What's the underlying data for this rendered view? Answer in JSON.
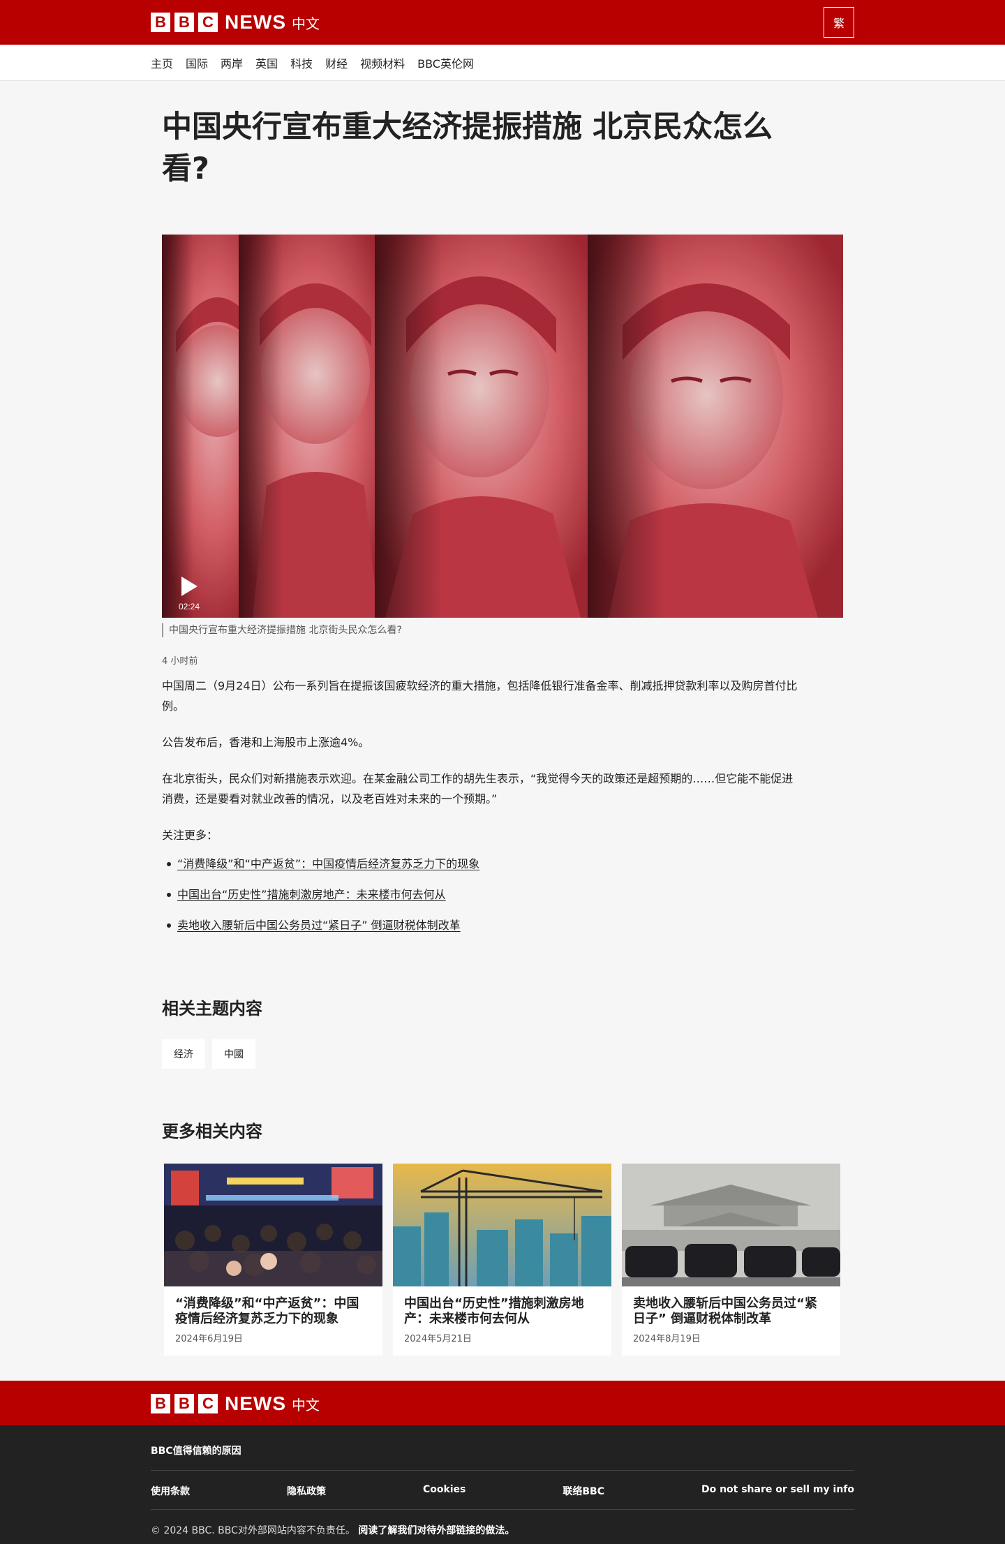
{
  "header": {
    "logo_letters": [
      "B",
      "B",
      "C"
    ],
    "logo_news": "NEWS",
    "logo_lang": "中文",
    "traditional_button": "繁"
  },
  "nav": {
    "items": [
      {
        "label": "主页"
      },
      {
        "label": "国际"
      },
      {
        "label": "两岸"
      },
      {
        "label": "英国"
      },
      {
        "label": "科技"
      },
      {
        "label": "财经"
      },
      {
        "label": "视频材料"
      },
      {
        "label": "BBC英伦网"
      }
    ]
  },
  "article": {
    "headline": "中国央行宣布重大经济提振措施 北京民众怎么看?",
    "video_duration": "02:24",
    "caption": "中国央行宣布重大经济提振措施 北京街头民众怎么看?",
    "timestamp": "4 小时前",
    "paragraphs": [
      "中国周二（9月24日）公布一系列旨在提振该国疲软经济的重大措施，包括降低银行准备金率、削减抵押贷款利率以及购房首付比例。",
      "公告发布后，香港和上海股市上涨逾4%。",
      "在北京街头，民众们对新措施表示欢迎。在某金融公司工作的胡先生表示，“我觉得今天的政策还是超预期的……但它能不能促进消费，还是要看对就业改善的情况，以及老百姓对未来的一个预期。”",
      "关注更多："
    ],
    "links": [
      "“消费降级”和“中产返贫”：中国疫情后经济复苏乏力下的现象",
      "中国出台“历史性”措施刺激房地产：未来楼市何去何从",
      "卖地收入腰斩后中国公务员过“紧日子” 倒逼财税体制改革"
    ]
  },
  "topics": {
    "title": "相关主题内容",
    "tags": [
      "经济",
      "中國"
    ]
  },
  "more": {
    "title": "更多相关内容",
    "cards": [
      {
        "title": "“消费降级”和“中产返贫”：中国疫情后经济复苏乏力下的现象",
        "date": "2024年6月19日"
      },
      {
        "title": "中国出台“历史性”措施刺激房地产：未来楼市何去何从",
        "date": "2024年5月21日"
      },
      {
        "title": "卖地收入腰斩后中国公务员过“紧日子” 倒逼财税体制改革",
        "date": "2024年8月19日"
      }
    ]
  },
  "footer": {
    "trust": "BBC值得信赖的原因",
    "links": [
      "使用条款",
      "隐私政策",
      "Cookies",
      "联络BBC",
      "Do not share or sell my info"
    ],
    "copyright": "© 2024 BBC. BBC对外部网站内容不负责任。",
    "external_policy": "阅读了解我们对待外部链接的做法。"
  },
  "colors": {
    "brand_red": "#b80000",
    "footer_bg": "#222222",
    "page_bg": "#f6f6f6"
  }
}
